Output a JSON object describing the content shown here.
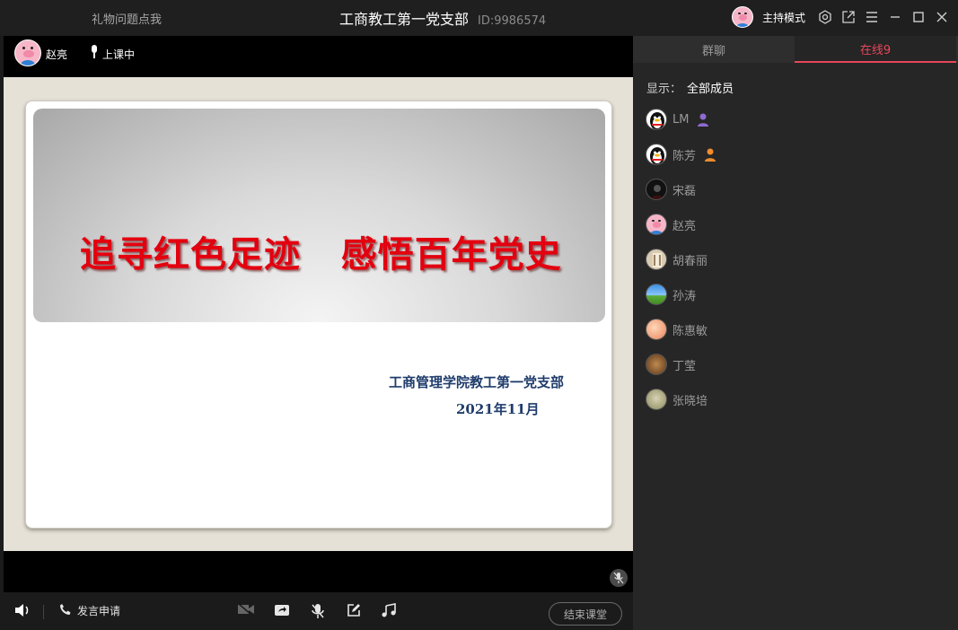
{
  "titlebar": {
    "left_text": "礼物问题点我",
    "title": "工商教工第一党支部",
    "room_id": "ID:9986574",
    "host_mode": "主持模式"
  },
  "teacher": {
    "name": "赵亮",
    "status": "上课中"
  },
  "slide": {
    "title": "追寻红色足迹   感悟百年党史",
    "org": "工商管理学院教工第一党支部",
    "date": "2021年11月"
  },
  "toolbar": {
    "apply_speak": "发言申请",
    "end_class": "结束课堂"
  },
  "panel": {
    "tabs": [
      {
        "label": "群聊",
        "active": false
      },
      {
        "label": "在线9",
        "active": true
      }
    ],
    "filter_label": "显示：",
    "filter_value": "全部成员",
    "members": [
      {
        "name": "LM",
        "avatar": "penguin",
        "role": "purple-person"
      },
      {
        "name": "陈芳",
        "avatar": "penguin",
        "role": "orange-person"
      },
      {
        "name": "宋磊",
        "avatar": "dark"
      },
      {
        "name": "赵亮",
        "avatar": "pig"
      },
      {
        "name": "胡春丽",
        "avatar": "photo-light"
      },
      {
        "name": "孙涛",
        "avatar": "landscape"
      },
      {
        "name": "陈惠敏",
        "avatar": "peach"
      },
      {
        "name": "丁莹",
        "avatar": "brown"
      },
      {
        "name": "张晓培",
        "avatar": "olive"
      }
    ]
  },
  "colors": {
    "accent": "#e8465a",
    "slide_title": "#e3000f",
    "slide_subtitle": "#1f3c6b"
  }
}
